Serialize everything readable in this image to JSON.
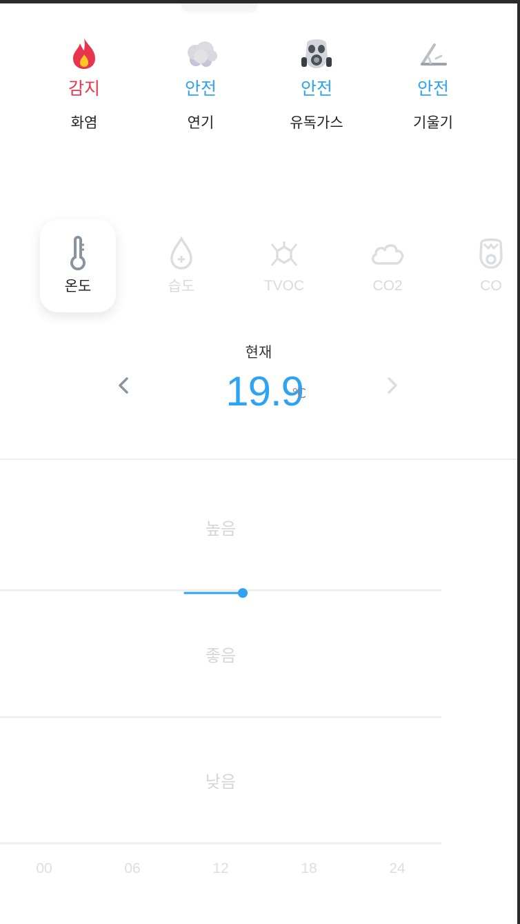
{
  "sensors": [
    {
      "name": "화염",
      "status": "감지",
      "status_color": "#e8344e",
      "icon": "flame-icon"
    },
    {
      "name": "연기",
      "status": "안전",
      "status_color": "#2ea3f2",
      "icon": "smoke-icon"
    },
    {
      "name": "유독가스",
      "status": "안전",
      "status_color": "#2ea3f2",
      "icon": "gas-mask-icon"
    },
    {
      "name": "기울기",
      "status": "안전",
      "status_color": "#2ea3f2",
      "icon": "tilt-icon"
    }
  ],
  "metrics": [
    {
      "label": "온도",
      "icon": "thermometer-icon",
      "active": true
    },
    {
      "label": "습도",
      "icon": "humidity-drop-icon",
      "active": false
    },
    {
      "label": "TVOC",
      "icon": "tvoc-molecule-icon",
      "active": false
    },
    {
      "label": "CO2",
      "icon": "co2-cloud-icon",
      "active": false
    },
    {
      "label": "CO",
      "icon": "co-mask-icon",
      "active": false
    }
  ],
  "current": {
    "label": "현재",
    "value": "19.9",
    "unit": "℃"
  },
  "chart_data": {
    "type": "line",
    "x_ticks": [
      "00",
      "06",
      "12",
      "18",
      "24"
    ],
    "bands": [
      "높음",
      "좋음",
      "낮음"
    ],
    "series": [
      {
        "color": "#2ea3f2",
        "points": [
          {
            "x": 9.5,
            "y": 19.9
          },
          {
            "x": 13.5,
            "y": 19.9
          }
        ]
      }
    ],
    "xlim": [
      0,
      24
    ]
  },
  "colors": {
    "accent": "#2ea3f2",
    "alert": "#e8344e"
  }
}
